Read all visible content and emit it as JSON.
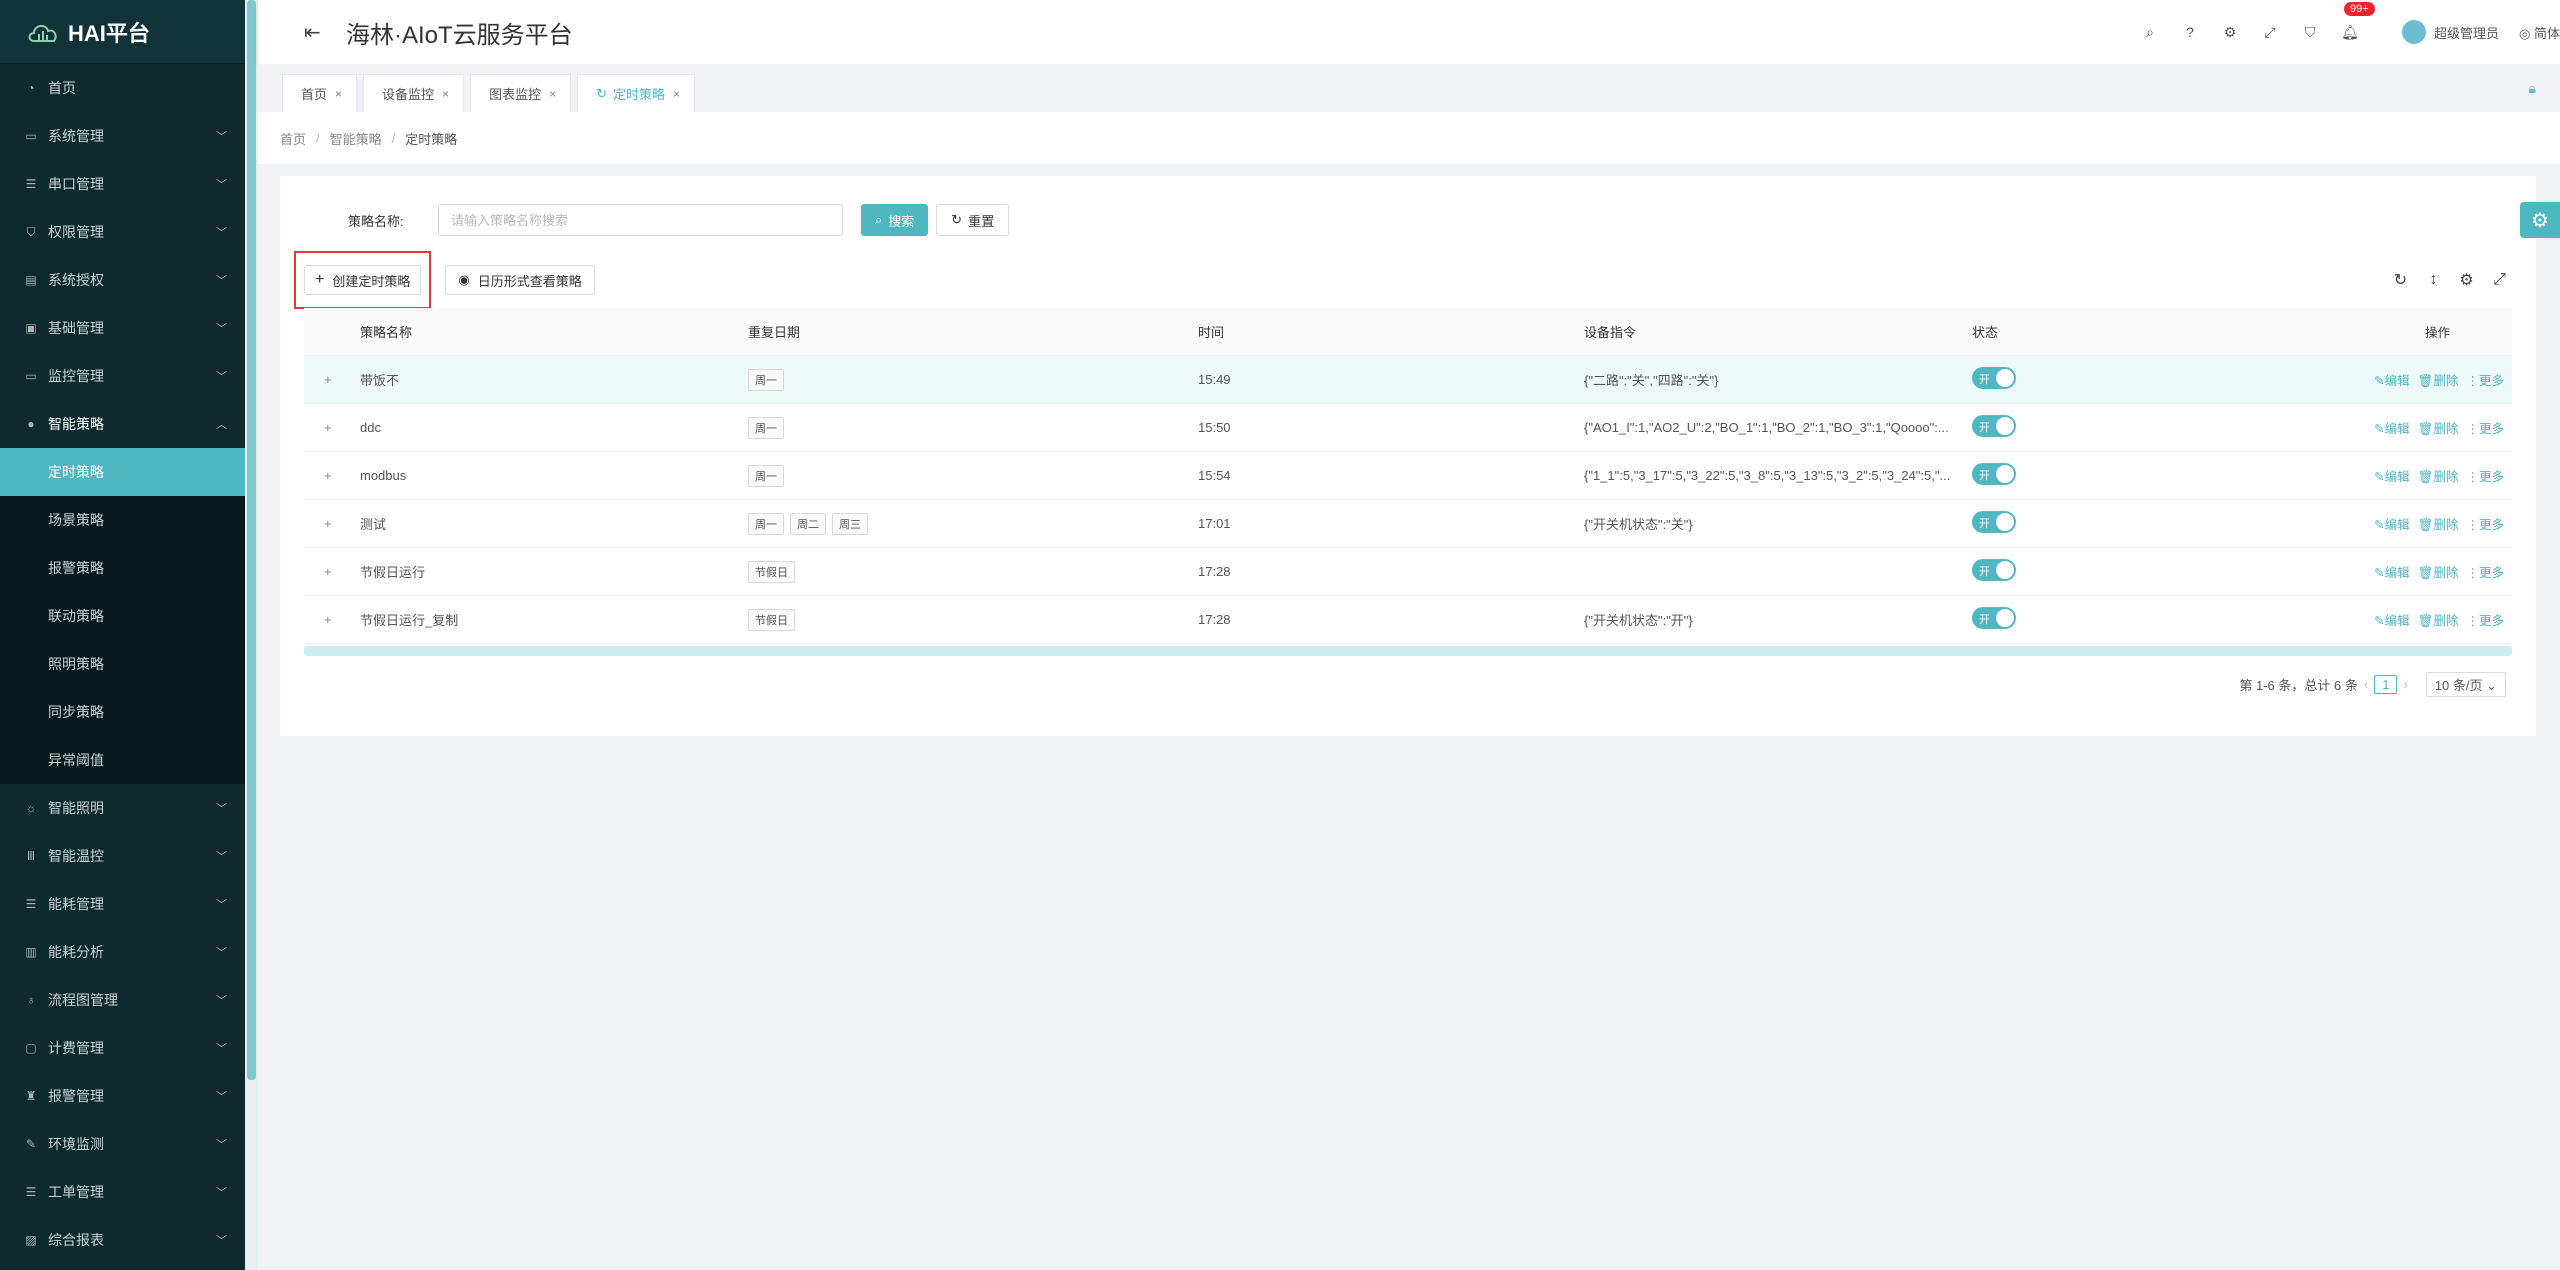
{
  "app": {
    "logo_text": "HAI平台",
    "title": "海林·AIoT云服务平台"
  },
  "header": {
    "badge": "99+",
    "user": "超级管理员",
    "lang": "简体"
  },
  "sidebar": {
    "items_top": [
      {
        "label": "首页",
        "icon": "dashboard-icon",
        "arrow": false
      },
      {
        "label": "系统管理",
        "icon": "monitor-icon",
        "arrow": true
      },
      {
        "label": "串口管理",
        "icon": "sliders-icon",
        "arrow": true
      },
      {
        "label": "权限管理",
        "icon": "shield-icon",
        "arrow": true
      },
      {
        "label": "系统授权",
        "icon": "license-icon",
        "arrow": true
      },
      {
        "label": "基础管理",
        "icon": "database-icon",
        "arrow": true
      },
      {
        "label": "监控管理",
        "icon": "monitor-icon",
        "arrow": true
      }
    ],
    "open_group": {
      "label": "智能策略",
      "icon": "location-icon"
    },
    "sub_items": [
      {
        "label": "定时策略",
        "active": true
      },
      {
        "label": "场景策略"
      },
      {
        "label": "报警策略"
      },
      {
        "label": "联动策略"
      },
      {
        "label": "照明策略"
      },
      {
        "label": "同步策略"
      },
      {
        "label": "异常阈值"
      }
    ],
    "items_bottom": [
      {
        "label": "智能照明",
        "icon": "bulb-icon"
      },
      {
        "label": "智能温控",
        "icon": "thermometer-icon"
      },
      {
        "label": "能耗管理",
        "icon": "sliders-icon"
      },
      {
        "label": "能耗分析",
        "icon": "bar-chart-icon"
      },
      {
        "label": "流程图管理",
        "icon": "flow-icon"
      },
      {
        "label": "计费管理",
        "icon": "billing-icon"
      },
      {
        "label": "报警管理",
        "icon": "alarm-icon"
      },
      {
        "label": "环境监测",
        "icon": "leaf-icon"
      },
      {
        "label": "工单管理",
        "icon": "ticket-icon"
      },
      {
        "label": "综合报表",
        "icon": "report-icon"
      }
    ]
  },
  "tabs": [
    {
      "label": "首页",
      "active": false
    },
    {
      "label": "设备监控",
      "active": false
    },
    {
      "label": "图表监控",
      "active": false
    },
    {
      "label": "定时策略",
      "active": true
    }
  ],
  "breadcrumb": [
    "首页",
    "智能策略",
    "定时策略"
  ],
  "search": {
    "label": "策略名称:",
    "placeholder": "请输入策略名称搜索",
    "search_btn": "搜索",
    "reset_btn": "重置"
  },
  "toolbar": {
    "create_btn": "创建定时策略",
    "calendar_btn": "日历形式查看策略"
  },
  "table": {
    "columns": [
      "策略名称",
      "重复日期",
      "时间",
      "设备指令",
      "状态",
      "操作"
    ],
    "rows": [
      {
        "name": "带饭不",
        "days": [
          "周一"
        ],
        "time": "15:49",
        "cmd": "{\"二路\":\"关\",\"四路\":\"关\"}",
        "status": "开"
      },
      {
        "name": "ddc",
        "days": [
          "周一"
        ],
        "time": "15:50",
        "cmd": "{\"AO1_I\":1,\"AO2_U\":2,\"BO_1\":1,\"BO_2\":1,\"BO_3\":1,\"Qoooo\":...",
        "status": "开"
      },
      {
        "name": "modbus",
        "days": [
          "周一"
        ],
        "time": "15:54",
        "cmd": "{\"1_1\":5,\"3_17\":5,\"3_22\":5,\"3_8\":5,\"3_13\":5,\"3_2\":5,\"3_24\":5,\"...",
        "status": "开"
      },
      {
        "name": "测试",
        "days": [
          "周一",
          "周二",
          "周三"
        ],
        "time": "17:01",
        "cmd": "{\"开关机状态\":\"关\"}",
        "status": "开"
      },
      {
        "name": "节假日运行",
        "days": [
          "节假日"
        ],
        "time": "17:28",
        "cmd": "",
        "status": "开"
      },
      {
        "name": "节假日运行_复制",
        "days": [
          "节假日"
        ],
        "time": "17:28",
        "cmd": "{\"开关机状态\":\"开\"}",
        "status": "开"
      }
    ],
    "ops": {
      "edit": "编辑",
      "delete": "删除",
      "more": "更多"
    },
    "expand": "+"
  },
  "pager": {
    "summary": "第 1-6 条，总计 6 条",
    "page": "1",
    "size": "10 条/页"
  },
  "colors": {
    "accent": "#4fb7c0",
    "sidebar_bg": "#0f2a2f",
    "highlight_border": "#e53935"
  }
}
